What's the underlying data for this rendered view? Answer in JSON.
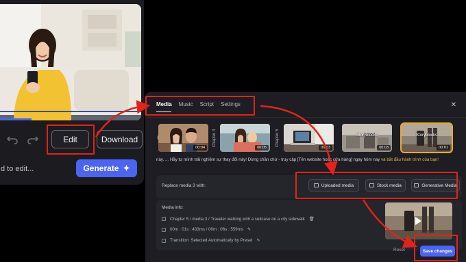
{
  "left_panel": {
    "edit_label": "Edit",
    "download_label": "Download",
    "input_placeholder": "d to edit...",
    "generate_label": "Generate"
  },
  "dialog": {
    "tabs": [
      "Media",
      "Music",
      "Script",
      "Settings"
    ],
    "active_tab": "Media",
    "thumbnails": [
      {
        "duration": "00:04",
        "label": ""
      },
      {
        "duration": "00:05",
        "label": ""
      },
      {
        "duration": "00:03",
        "label": ""
      },
      {
        "duration": "00:03",
        "label": "Storyblocks"
      },
      {
        "duration": "00:01",
        "label": "Storyblocks"
      }
    ],
    "chapter_tags": [
      "Chapter 4",
      "Chapter 5"
    ],
    "script_text": "này. ... Hãy tự mình trải nghiệm sự thay đổi này! Đừng chần chừ - truy cập [Tên website hoặc cửa hàng] ngay hôm nay ",
    "script_highlight": "và bắt đầu hành trình của bạn!",
    "replace_label": "Replace media 3 with:",
    "replace_options": [
      "Uploaded media",
      "Stock media",
      "Generative Media"
    ],
    "info_title": "Media info:",
    "info_rows": [
      "Chapter 5 / media 3 / Traveler walking with a suitcase on a city sidewalk",
      "00m : 01s : 433ms / 00m : 06s : 559ms",
      "Transition: Selected Automatically by Preset"
    ],
    "reset_label": "Reset",
    "save_label": "Save changes",
    "accent_color": "#4c64f2",
    "selected_outline_color": "#e8a934",
    "annotation_color": "#e2231a"
  }
}
